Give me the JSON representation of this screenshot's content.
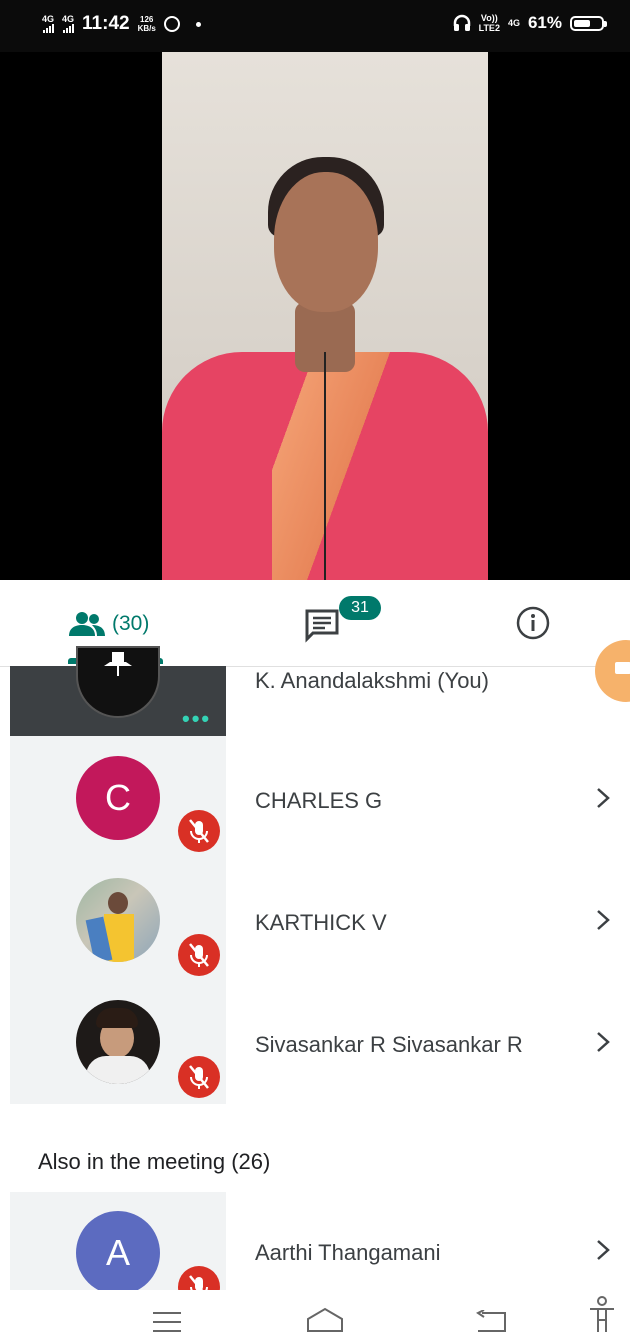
{
  "status_bar": {
    "sim1_label": "4G",
    "sim2_label": "4G",
    "time": "11:42",
    "speed_value": "126",
    "speed_unit": "KB/s",
    "volte_top": "Vo))",
    "volte_bottom": "LTE2",
    "net_label": "4G",
    "battery_percent": "61%",
    "battery_level": 0.61
  },
  "tabs": {
    "people_count": "(30)",
    "chat_badge": "31"
  },
  "participants": [
    {
      "name": "K. Anandalakshmi (You)",
      "avatar_type": "dark-icon",
      "muted": false
    },
    {
      "name": "CHARLES G",
      "avatar_type": "letter",
      "letter": "C",
      "color": "#c2185b",
      "muted": true
    },
    {
      "name": "KARTHICK V",
      "avatar_type": "photo",
      "muted": true
    },
    {
      "name": "Sivasankar R Sivasankar R",
      "avatar_type": "photo",
      "muted": true
    }
  ],
  "also_section": {
    "title": "Also in the meeting (26)",
    "items": [
      {
        "name": "Aarthi Thangamani",
        "avatar_type": "letter",
        "letter": "A",
        "color": "#5c6bc0",
        "muted": true
      }
    ]
  },
  "colors": {
    "accent": "#00796b",
    "mute": "#d93025",
    "tile_bg": "#f1f3f4"
  }
}
